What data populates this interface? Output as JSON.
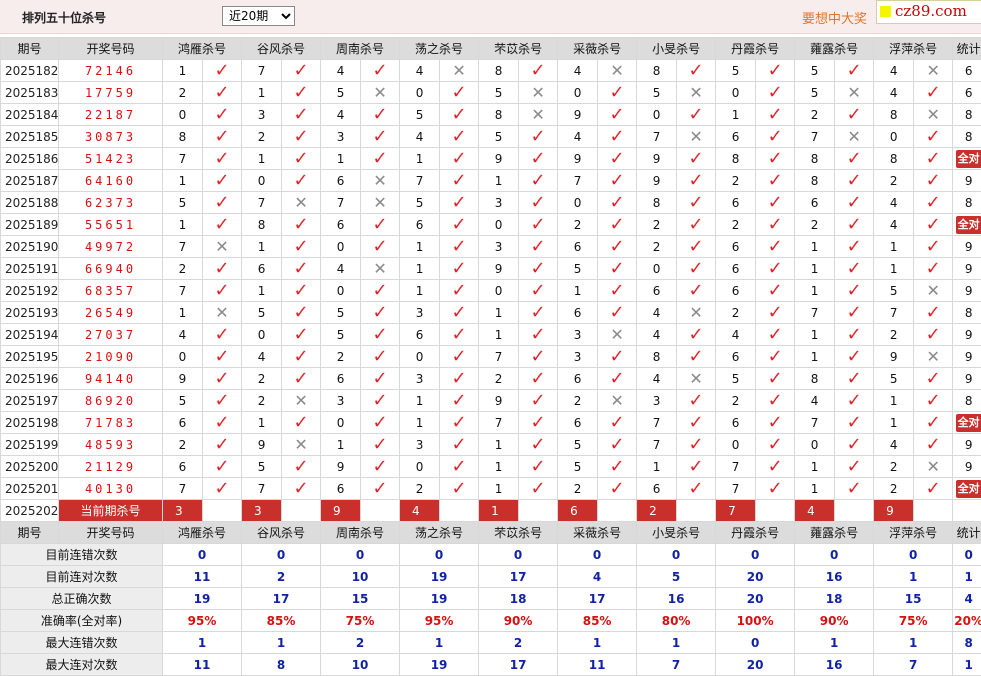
{
  "header": {
    "title": "排列五十位杀号",
    "period_select": "近20期",
    "ad_text": "要想中大奖",
    "logo_text": "cz89.com"
  },
  "columns": {
    "period": "期号",
    "draw": "开奖号码",
    "experts": [
      "鸿雁杀号",
      "谷风杀号",
      "周南杀号",
      "荡之杀号",
      "芣苡杀号",
      "采薇杀号",
      "小旻杀号",
      "丹霞杀号",
      "蕹露杀号",
      "浮萍杀号"
    ],
    "stat": "统计"
  },
  "rows": [
    {
      "p": "2025182",
      "d": "72146",
      "k": [
        1,
        7,
        4,
        4,
        8,
        4,
        8,
        5,
        5,
        4
      ],
      "r": [
        1,
        1,
        1,
        0,
        1,
        0,
        1,
        1,
        1,
        0
      ],
      "s": "6"
    },
    {
      "p": "2025183",
      "d": "17759",
      "k": [
        2,
        1,
        5,
        0,
        5,
        0,
        5,
        0,
        5,
        4
      ],
      "r": [
        1,
        1,
        0,
        1,
        0,
        1,
        0,
        1,
        0,
        1
      ],
      "s": "6"
    },
    {
      "p": "2025184",
      "d": "22187",
      "k": [
        0,
        3,
        4,
        5,
        8,
        9,
        0,
        1,
        2,
        8
      ],
      "r": [
        1,
        1,
        1,
        1,
        0,
        1,
        1,
        1,
        1,
        0
      ],
      "s": "8"
    },
    {
      "p": "2025185",
      "d": "30873",
      "k": [
        8,
        2,
        3,
        4,
        5,
        4,
        7,
        6,
        7,
        0
      ],
      "r": [
        1,
        1,
        1,
        1,
        1,
        1,
        0,
        1,
        0,
        1
      ],
      "s": "8"
    },
    {
      "p": "2025186",
      "d": "51423",
      "k": [
        7,
        1,
        1,
        1,
        9,
        9,
        9,
        8,
        8,
        8
      ],
      "r": [
        1,
        1,
        1,
        1,
        1,
        1,
        1,
        1,
        1,
        1
      ],
      "s": "全对"
    },
    {
      "p": "2025187",
      "d": "64160",
      "k": [
        1,
        0,
        6,
        7,
        1,
        7,
        9,
        2,
        8,
        2
      ],
      "r": [
        1,
        1,
        0,
        1,
        1,
        1,
        1,
        1,
        1,
        1
      ],
      "s": "9"
    },
    {
      "p": "2025188",
      "d": "62373",
      "k": [
        5,
        7,
        7,
        5,
        3,
        0,
        8,
        6,
        6,
        4
      ],
      "r": [
        1,
        0,
        0,
        1,
        1,
        1,
        1,
        1,
        1,
        1
      ],
      "s": "8"
    },
    {
      "p": "2025189",
      "d": "55651",
      "k": [
        1,
        8,
        6,
        6,
        0,
        2,
        2,
        2,
        2,
        4
      ],
      "r": [
        1,
        1,
        1,
        1,
        1,
        1,
        1,
        1,
        1,
        1
      ],
      "s": "全对"
    },
    {
      "p": "2025190",
      "d": "49972",
      "k": [
        7,
        1,
        0,
        1,
        3,
        6,
        2,
        6,
        1,
        1
      ],
      "r": [
        0,
        1,
        1,
        1,
        1,
        1,
        1,
        1,
        1,
        1
      ],
      "s": "9"
    },
    {
      "p": "2025191",
      "d": "66940",
      "k": [
        2,
        6,
        4,
        1,
        9,
        5,
        0,
        6,
        1,
        1
      ],
      "r": [
        1,
        1,
        0,
        1,
        1,
        1,
        1,
        1,
        1,
        1
      ],
      "s": "9"
    },
    {
      "p": "2025192",
      "d": "68357",
      "k": [
        7,
        1,
        0,
        1,
        0,
        1,
        6,
        6,
        1,
        5
      ],
      "r": [
        1,
        1,
        1,
        1,
        1,
        1,
        1,
        1,
        1,
        0
      ],
      "s": "9"
    },
    {
      "p": "2025193",
      "d": "26549",
      "k": [
        1,
        5,
        5,
        3,
        1,
        6,
        4,
        2,
        7,
        7
      ],
      "r": [
        0,
        1,
        1,
        1,
        1,
        1,
        0,
        1,
        1,
        1
      ],
      "s": "8"
    },
    {
      "p": "2025194",
      "d": "27037",
      "k": [
        4,
        0,
        5,
        6,
        1,
        3,
        4,
        4,
        1,
        2
      ],
      "r": [
        1,
        1,
        1,
        1,
        1,
        0,
        1,
        1,
        1,
        1
      ],
      "s": "9"
    },
    {
      "p": "2025195",
      "d": "21090",
      "k": [
        0,
        4,
        2,
        0,
        7,
        3,
        8,
        6,
        1,
        9
      ],
      "r": [
        1,
        1,
        1,
        1,
        1,
        1,
        1,
        1,
        1,
        0
      ],
      "s": "9"
    },
    {
      "p": "2025196",
      "d": "94140",
      "k": [
        9,
        2,
        6,
        3,
        2,
        6,
        4,
        5,
        8,
        5
      ],
      "r": [
        1,
        1,
        1,
        1,
        1,
        1,
        0,
        1,
        1,
        1
      ],
      "s": "9"
    },
    {
      "p": "2025197",
      "d": "86920",
      "k": [
        5,
        2,
        3,
        1,
        9,
        2,
        3,
        2,
        4,
        1
      ],
      "r": [
        1,
        0,
        1,
        1,
        1,
        0,
        1,
        1,
        1,
        1
      ],
      "s": "8"
    },
    {
      "p": "2025198",
      "d": "71783",
      "k": [
        6,
        1,
        0,
        1,
        7,
        6,
        7,
        6,
        7,
        1
      ],
      "r": [
        1,
        1,
        1,
        1,
        1,
        1,
        1,
        1,
        1,
        1
      ],
      "s": "全对"
    },
    {
      "p": "2025199",
      "d": "48593",
      "k": [
        2,
        9,
        1,
        3,
        1,
        5,
        7,
        0,
        0,
        4
      ],
      "r": [
        1,
        0,
        1,
        1,
        1,
        1,
        1,
        1,
        1,
        1
      ],
      "s": "9"
    },
    {
      "p": "2025200",
      "d": "21129",
      "k": [
        6,
        5,
        9,
        0,
        1,
        5,
        1,
        7,
        1,
        2
      ],
      "r": [
        1,
        1,
        1,
        1,
        1,
        1,
        1,
        1,
        1,
        0
      ],
      "s": "9"
    },
    {
      "p": "2025201",
      "d": "40130",
      "k": [
        7,
        7,
        6,
        2,
        1,
        2,
        6,
        7,
        1,
        2
      ],
      "r": [
        1,
        1,
        1,
        1,
        1,
        1,
        1,
        1,
        1,
        1
      ],
      "s": "全对"
    }
  ],
  "current": {
    "period": "2025202",
    "label": "当前期杀号",
    "kills": [
      "3",
      "3",
      "9",
      "4",
      "1",
      "6",
      "2",
      "7",
      "4",
      "9"
    ]
  },
  "summary": [
    {
      "label": "目前连错次数",
      "values": [
        "0",
        "0",
        "0",
        "0",
        "0",
        "0",
        "0",
        "0",
        "0",
        "0"
      ],
      "stat": "0"
    },
    {
      "label": "目前连对次数",
      "values": [
        "11",
        "2",
        "10",
        "19",
        "17",
        "4",
        "5",
        "20",
        "16",
        "1"
      ],
      "stat": "1"
    },
    {
      "label": "总正确次数",
      "values": [
        "19",
        "17",
        "15",
        "19",
        "18",
        "17",
        "16",
        "20",
        "18",
        "15"
      ],
      "stat": "4"
    },
    {
      "label": "准确率(全对率)",
      "values": [
        "95%",
        "85%",
        "75%",
        "95%",
        "90%",
        "85%",
        "80%",
        "100%",
        "90%",
        "75%"
      ],
      "stat": "20%"
    },
    {
      "label": "最大连错次数",
      "values": [
        "1",
        "1",
        "2",
        "1",
        "2",
        "1",
        "1",
        "0",
        "1",
        "1"
      ],
      "stat": "8"
    },
    {
      "label": "最大连对次数",
      "values": [
        "11",
        "8",
        "10",
        "19",
        "17",
        "11",
        "7",
        "20",
        "16",
        "7"
      ],
      "stat": "1"
    }
  ],
  "marks": {
    "ok": "✓",
    "no": "✕"
  },
  "colors": {
    "accent_red": "#c9302c",
    "check_red": "#e0262b",
    "summary_blue": "#1222a8",
    "header_gray": "#dcdcdc"
  }
}
